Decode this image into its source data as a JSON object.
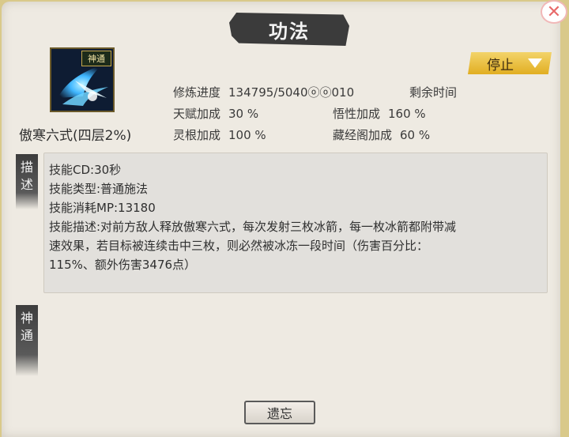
{
  "window": {
    "title": "功法",
    "close_icon": "close-icon",
    "stop_label": "停止"
  },
  "skill": {
    "badge": "神通",
    "name": "傲寒六式(四层2%)",
    "icon": "ice-arrow-skill-icon"
  },
  "stats": {
    "progress_label": "修炼进度",
    "progress_value": "134795/5040ⓞⓞ010",
    "remaining_label": "剩余时间",
    "remaining_value": "",
    "talent_label": "天赋加成",
    "talent_value": "30 %",
    "comprehension_label": "悟性加成",
    "comprehension_value": "160 %",
    "root_label": "灵根加成",
    "root_value": "100 %",
    "library_label": "藏经阁加成",
    "library_value": "60 %"
  },
  "tabs": {
    "describe": "描述",
    "divine": "神通"
  },
  "description": {
    "line1": "技能CD:30秒",
    "line2": "技能类型:普通施法",
    "line3": "技能消耗MP:13180",
    "line4": "技能描述:对前方敌人释放傲寒六式，每次发射三枚冰箭，每一枚冰箭都附带减",
    "line5": "速效果，若目标被连续击中三枚，则必然被冰冻一段时间（伤害百分比：",
    "line6": "115%、额外伤害3476点）"
  },
  "buttons": {
    "forget": "遗忘"
  },
  "colors": {
    "frame": "#d9c98a",
    "panel": "#eeeae2",
    "stop_button": "#e8b930"
  }
}
